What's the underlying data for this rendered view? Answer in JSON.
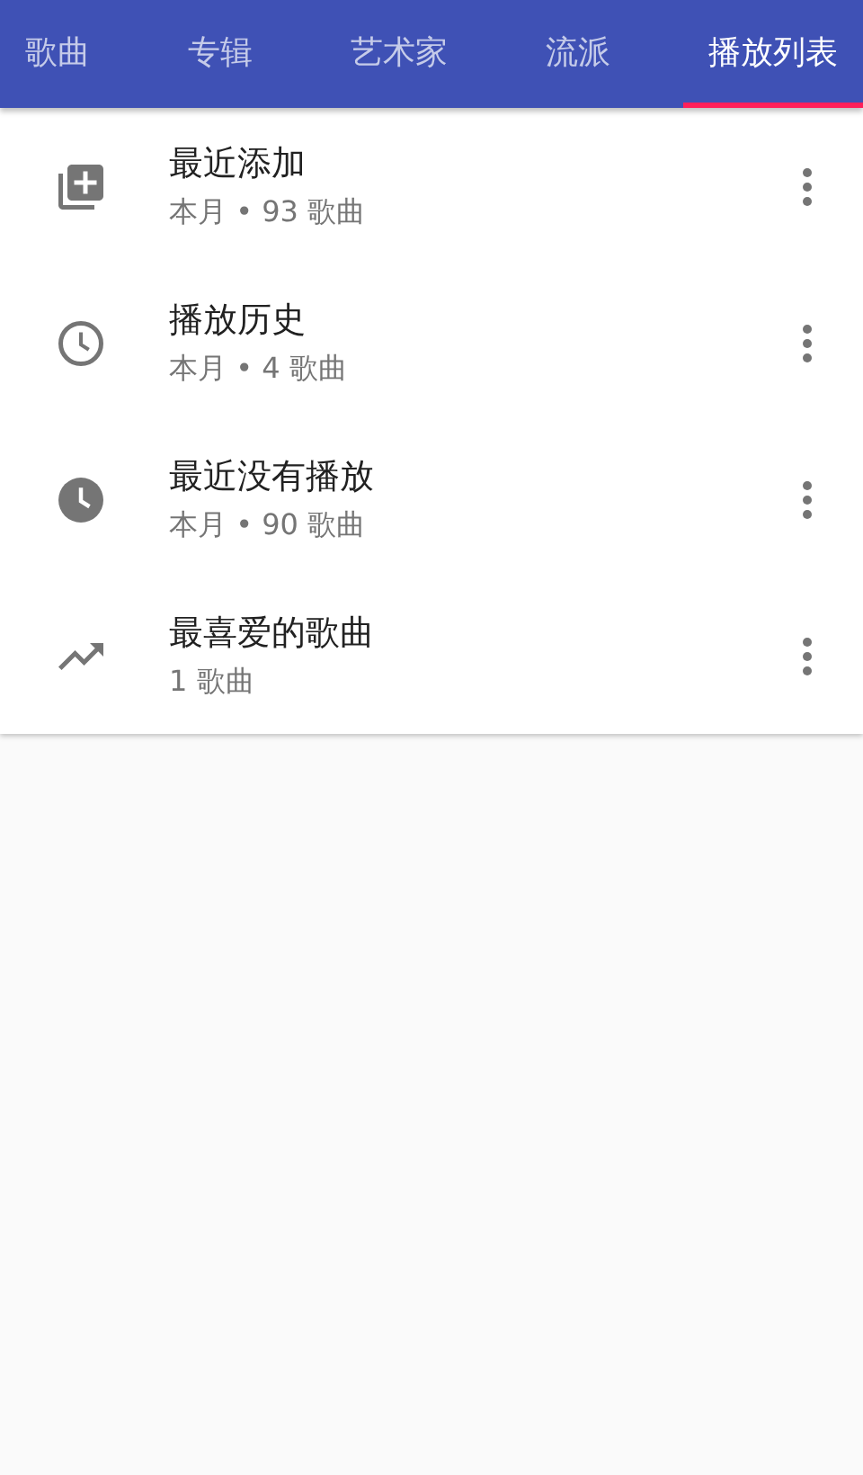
{
  "tabs": [
    {
      "label": "歌曲",
      "selected": false
    },
    {
      "label": "专辑",
      "selected": false
    },
    {
      "label": "艺术家",
      "selected": false
    },
    {
      "label": "流派",
      "selected": false
    },
    {
      "label": "播放列表",
      "selected": true
    }
  ],
  "playlists": [
    {
      "kind": "added",
      "title": "最近添加",
      "subtitle": "本月 • 93 歌曲"
    },
    {
      "kind": "history",
      "title": "播放历史",
      "subtitle": "本月 • 4 歌曲"
    },
    {
      "kind": "unplayed",
      "title": "最近没有播放",
      "subtitle": "本月 • 90 歌曲"
    },
    {
      "kind": "favorite",
      "title": "最喜爱的歌曲",
      "subtitle": "1 歌曲"
    }
  ]
}
